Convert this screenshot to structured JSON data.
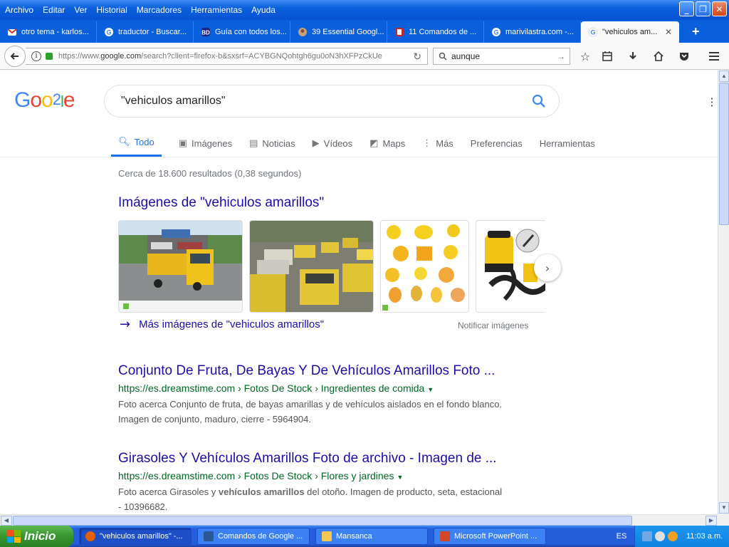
{
  "menubar": {
    "items": [
      "Archivo",
      "Editar",
      "Ver",
      "Historial",
      "Marcadores",
      "Herramientas",
      "Ayuda"
    ]
  },
  "tabs": [
    {
      "label": "otro tema - karlos...",
      "icon": "gmail-icon",
      "color": "#d93025"
    },
    {
      "label": "traductor - Buscar...",
      "icon": "google-icon",
      "color": "#ffffff"
    },
    {
      "label": "Guía con todos los...",
      "icon": "bd-icon",
      "color": "#1a237e"
    },
    {
      "label": "39 Essential Googl...",
      "icon": "avatar-icon",
      "color": "#c9a27a"
    },
    {
      "label": "11 Comandos de ...",
      "icon": "bookmark-site-icon",
      "color": "#c62828"
    },
    {
      "label": "marivilastra.com -...",
      "icon": "google-icon",
      "color": "#ffffff"
    },
    {
      "label": "\"vehiculos am...",
      "icon": "google-icon",
      "color": "#4285f4",
      "active": true
    }
  ],
  "navbar": {
    "url_prefix": "https://www.",
    "url_host": "google.com",
    "url_rest": "/search?client=firefox-b&sxsrf=ACYBGNQohtgh6gu0oN3hXFPzCkUeB",
    "search_value": "aunque"
  },
  "google": {
    "logo": "Goo2le",
    "query": "\"vehiculos amarillos\"",
    "tabs": [
      {
        "label": "Todo",
        "icon": "search-icon",
        "active": true
      },
      {
        "label": "Imágenes",
        "icon": "image-icon"
      },
      {
        "label": "Noticias",
        "icon": "news-icon"
      },
      {
        "label": "Vídeos",
        "icon": "video-icon"
      },
      {
        "label": "Maps",
        "icon": "map-icon"
      },
      {
        "label": "Más",
        "icon": "more-vert-icon"
      },
      {
        "label": "Preferencias",
        "icon": ""
      },
      {
        "label": "Herramientas",
        "icon": ""
      }
    ],
    "stats": "Cerca de 18.600 resultados (0,38 segundos)",
    "images_heading": "Imágenes de \"vehiculos amarillos\"",
    "more_images": "Más imágenes de \"vehiculos amarillos\"",
    "report_images": "Notificar imágenes",
    "results": [
      {
        "title": "Conjunto De Fruta, De Bayas Y De Vehículos Amarillos Foto ...",
        "url": "https://es.dreamstime.com › Fotos De Stock › Ingredientes de comida",
        "snippet_1": "Foto acerca Conjunto de fruta, de bayas amarillas y de vehículos aislados en el fondo blanco.",
        "snippet_2": "Imagen de conjunto, maduro, cierre - 5964904."
      },
      {
        "title": "Girasoles Y Vehículos Amarillos Foto de archivo - Imagen de ...",
        "url": "https://es.dreamstime.com › Fotos De Stock › Flores y jardines",
        "snippet_pre": "Foto acerca Girasoles y ",
        "snippet_bold": "vehículos amarillos",
        "snippet_post": " del otoño. Imagen de producto, seta, estacional",
        "snippet_2": "- 10396682."
      }
    ]
  },
  "taskbar": {
    "start": "Inicio",
    "tasks": [
      {
        "label": "\"vehiculos amarillos\" -...",
        "icon": "firefox-icon",
        "color": "#e66000"
      },
      {
        "label": "Comandos de Google ...",
        "icon": "word-icon",
        "color": "#2b5797"
      },
      {
        "label": "Mansanca",
        "icon": "folder-icon",
        "color": "#f3c852"
      },
      {
        "label": "Microsoft PowerPoint ...",
        "icon": "powerpoint-icon",
        "color": "#d24726"
      }
    ],
    "language": "ES",
    "clock": "11:03 a.m."
  }
}
